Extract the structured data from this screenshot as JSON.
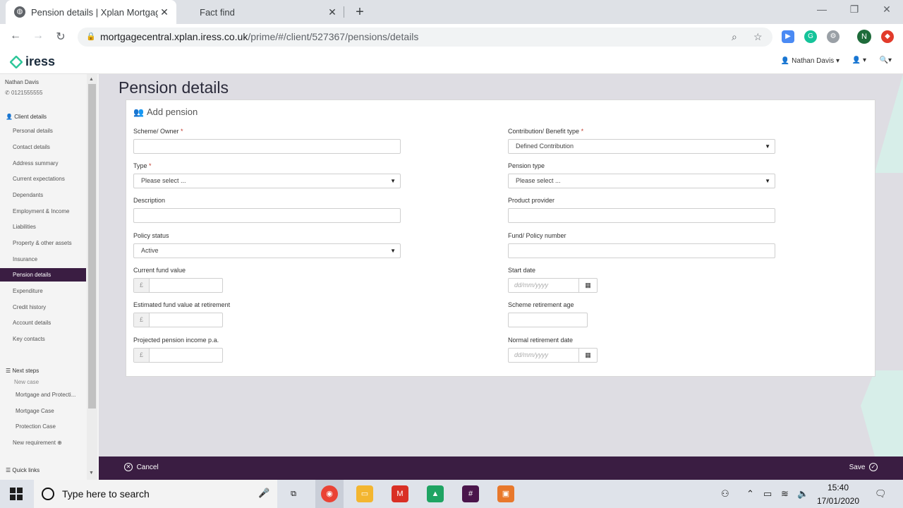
{
  "browser": {
    "tabs": [
      {
        "label": "Pension details | Xplan Mortgage",
        "active": true
      },
      {
        "label": "Fact find",
        "active": false
      }
    ],
    "url_host": "mortgagecentral.xplan.iress.co.uk",
    "url_path": "/prime/#/client/527367/pensions/details",
    "profile_initial": "N"
  },
  "header": {
    "logo": "iress",
    "user_menu": "Nathan Davis"
  },
  "sidebar": {
    "client_name": "Nathan Davis",
    "client_phone": "0121555555",
    "section_title": "Client details",
    "items": [
      "Personal details",
      "Contact details",
      "Address summary",
      "Current expectations",
      "Dependants",
      "Employment & Income",
      "Liabilities",
      "Property & other assets",
      "Insurance",
      "Pension details",
      "Expenditure",
      "Credit history",
      "Account details",
      "Key contacts"
    ],
    "active_item": "Pension details",
    "next_steps_title": "Next steps",
    "new_case_label": "New case",
    "case_items": [
      "Mortgage and Protecti...",
      "Mortgage Case",
      "Protection Case"
    ],
    "new_requirement": "New requirement",
    "quick_links": "Quick links"
  },
  "page": {
    "title": "Pension details",
    "card_title": "Add pension",
    "fields": {
      "scheme_owner": {
        "label": "Scheme/ Owner",
        "value": ""
      },
      "type": {
        "label": "Type",
        "value": "Please select ..."
      },
      "description": {
        "label": "Description",
        "value": ""
      },
      "policy_status": {
        "label": "Policy status",
        "value": "Active"
      },
      "current_fund_value": {
        "label": "Current fund value",
        "currency": "£",
        "value": ""
      },
      "estimated_fund_value": {
        "label": "Estimated fund value at retirement",
        "currency": "£",
        "value": ""
      },
      "projected_income": {
        "label": "Projected pension income p.a.",
        "currency": "£",
        "value": ""
      },
      "contribution_type": {
        "label": "Contribution/ Benefit type",
        "value": "Defined Contribution"
      },
      "pension_type": {
        "label": "Pension type",
        "value": "Please select ..."
      },
      "product_provider": {
        "label": "Product provider",
        "value": ""
      },
      "fund_policy_number": {
        "label": "Fund/ Policy number",
        "value": ""
      },
      "start_date": {
        "label": "Start date",
        "placeholder": "dd/mm/yyyy"
      },
      "scheme_retirement_age": {
        "label": "Scheme retirement age",
        "value": ""
      },
      "normal_retirement_date": {
        "label": "Normal retirement date",
        "placeholder": "dd/mm/yyyy"
      }
    },
    "required_mark": "*"
  },
  "footer": {
    "cancel_label": "Cancel",
    "save_label": "Save"
  },
  "taskbar": {
    "search_placeholder": "Type here to search",
    "time": "15:40",
    "date": "17/01/2020"
  },
  "colors": {
    "brand_purple": "#3a1d42",
    "accent_green": "#2fc79a",
    "required_red": "#c0392b"
  }
}
